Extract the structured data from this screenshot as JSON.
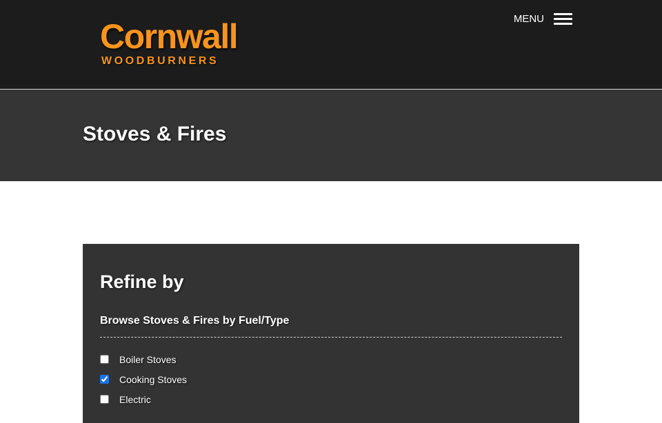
{
  "header": {
    "logo": {
      "main": "Cornwall",
      "sub": "WOODBURNERS",
      "color": "#f7941d"
    },
    "menu": {
      "label": "MENU",
      "icon": "hamburger-icon"
    }
  },
  "banner": {
    "title": "Stoves & Fires"
  },
  "filters": {
    "heading": "Refine by",
    "group_title": "Browse Stoves & Fires by Fuel/Type",
    "options": [
      {
        "label": "Boiler Stoves",
        "checked": false
      },
      {
        "label": "Cooking Stoves",
        "checked": true
      },
      {
        "label": "Electric",
        "checked": false
      }
    ]
  }
}
